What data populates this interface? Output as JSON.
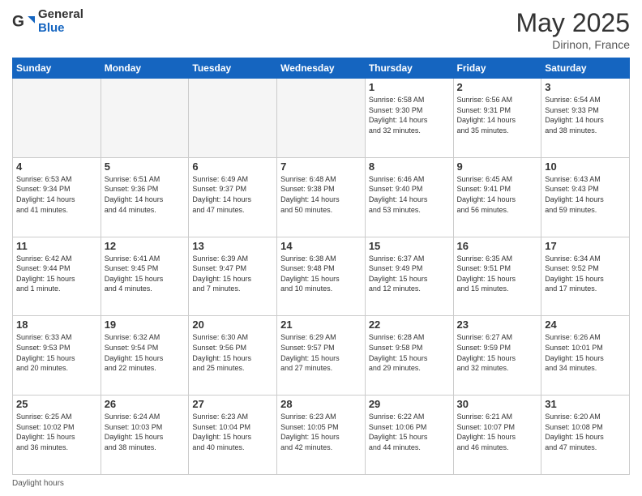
{
  "header": {
    "logo_general": "General",
    "logo_blue": "Blue",
    "month_title": "May 2025",
    "location": "Dirinon, France"
  },
  "days_of_week": [
    "Sunday",
    "Monday",
    "Tuesday",
    "Wednesday",
    "Thursday",
    "Friday",
    "Saturday"
  ],
  "weeks": [
    [
      {
        "num": "",
        "info": ""
      },
      {
        "num": "",
        "info": ""
      },
      {
        "num": "",
        "info": ""
      },
      {
        "num": "",
        "info": ""
      },
      {
        "num": "1",
        "info": "Sunrise: 6:58 AM\nSunset: 9:30 PM\nDaylight: 14 hours\nand 32 minutes."
      },
      {
        "num": "2",
        "info": "Sunrise: 6:56 AM\nSunset: 9:31 PM\nDaylight: 14 hours\nand 35 minutes."
      },
      {
        "num": "3",
        "info": "Sunrise: 6:54 AM\nSunset: 9:33 PM\nDaylight: 14 hours\nand 38 minutes."
      }
    ],
    [
      {
        "num": "4",
        "info": "Sunrise: 6:53 AM\nSunset: 9:34 PM\nDaylight: 14 hours\nand 41 minutes."
      },
      {
        "num": "5",
        "info": "Sunrise: 6:51 AM\nSunset: 9:36 PM\nDaylight: 14 hours\nand 44 minutes."
      },
      {
        "num": "6",
        "info": "Sunrise: 6:49 AM\nSunset: 9:37 PM\nDaylight: 14 hours\nand 47 minutes."
      },
      {
        "num": "7",
        "info": "Sunrise: 6:48 AM\nSunset: 9:38 PM\nDaylight: 14 hours\nand 50 minutes."
      },
      {
        "num": "8",
        "info": "Sunrise: 6:46 AM\nSunset: 9:40 PM\nDaylight: 14 hours\nand 53 minutes."
      },
      {
        "num": "9",
        "info": "Sunrise: 6:45 AM\nSunset: 9:41 PM\nDaylight: 14 hours\nand 56 minutes."
      },
      {
        "num": "10",
        "info": "Sunrise: 6:43 AM\nSunset: 9:43 PM\nDaylight: 14 hours\nand 59 minutes."
      }
    ],
    [
      {
        "num": "11",
        "info": "Sunrise: 6:42 AM\nSunset: 9:44 PM\nDaylight: 15 hours\nand 1 minute."
      },
      {
        "num": "12",
        "info": "Sunrise: 6:41 AM\nSunset: 9:45 PM\nDaylight: 15 hours\nand 4 minutes."
      },
      {
        "num": "13",
        "info": "Sunrise: 6:39 AM\nSunset: 9:47 PM\nDaylight: 15 hours\nand 7 minutes."
      },
      {
        "num": "14",
        "info": "Sunrise: 6:38 AM\nSunset: 9:48 PM\nDaylight: 15 hours\nand 10 minutes."
      },
      {
        "num": "15",
        "info": "Sunrise: 6:37 AM\nSunset: 9:49 PM\nDaylight: 15 hours\nand 12 minutes."
      },
      {
        "num": "16",
        "info": "Sunrise: 6:35 AM\nSunset: 9:51 PM\nDaylight: 15 hours\nand 15 minutes."
      },
      {
        "num": "17",
        "info": "Sunrise: 6:34 AM\nSunset: 9:52 PM\nDaylight: 15 hours\nand 17 minutes."
      }
    ],
    [
      {
        "num": "18",
        "info": "Sunrise: 6:33 AM\nSunset: 9:53 PM\nDaylight: 15 hours\nand 20 minutes."
      },
      {
        "num": "19",
        "info": "Sunrise: 6:32 AM\nSunset: 9:54 PM\nDaylight: 15 hours\nand 22 minutes."
      },
      {
        "num": "20",
        "info": "Sunrise: 6:30 AM\nSunset: 9:56 PM\nDaylight: 15 hours\nand 25 minutes."
      },
      {
        "num": "21",
        "info": "Sunrise: 6:29 AM\nSunset: 9:57 PM\nDaylight: 15 hours\nand 27 minutes."
      },
      {
        "num": "22",
        "info": "Sunrise: 6:28 AM\nSunset: 9:58 PM\nDaylight: 15 hours\nand 29 minutes."
      },
      {
        "num": "23",
        "info": "Sunrise: 6:27 AM\nSunset: 9:59 PM\nDaylight: 15 hours\nand 32 minutes."
      },
      {
        "num": "24",
        "info": "Sunrise: 6:26 AM\nSunset: 10:01 PM\nDaylight: 15 hours\nand 34 minutes."
      }
    ],
    [
      {
        "num": "25",
        "info": "Sunrise: 6:25 AM\nSunset: 10:02 PM\nDaylight: 15 hours\nand 36 minutes."
      },
      {
        "num": "26",
        "info": "Sunrise: 6:24 AM\nSunset: 10:03 PM\nDaylight: 15 hours\nand 38 minutes."
      },
      {
        "num": "27",
        "info": "Sunrise: 6:23 AM\nSunset: 10:04 PM\nDaylight: 15 hours\nand 40 minutes."
      },
      {
        "num": "28",
        "info": "Sunrise: 6:23 AM\nSunset: 10:05 PM\nDaylight: 15 hours\nand 42 minutes."
      },
      {
        "num": "29",
        "info": "Sunrise: 6:22 AM\nSunset: 10:06 PM\nDaylight: 15 hours\nand 44 minutes."
      },
      {
        "num": "30",
        "info": "Sunrise: 6:21 AM\nSunset: 10:07 PM\nDaylight: 15 hours\nand 46 minutes."
      },
      {
        "num": "31",
        "info": "Sunrise: 6:20 AM\nSunset: 10:08 PM\nDaylight: 15 hours\nand 47 minutes."
      }
    ]
  ],
  "footer": {
    "daylight_label": "Daylight hours"
  }
}
